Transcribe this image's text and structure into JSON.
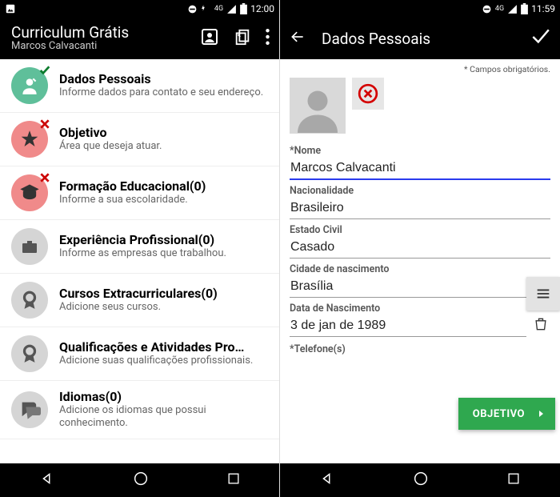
{
  "left": {
    "status": {
      "time": "12:00",
      "net": "4G"
    },
    "app_title": "Curriculum Grátis",
    "app_subtitle": "Marcos Calvacanti",
    "items": [
      {
        "title": "Dados Pessoais",
        "sub": "Informe dados para contato e seu endereço.",
        "color": "green",
        "badge": "check"
      },
      {
        "title": "Objetivo",
        "sub": "Área que deseja atuar.",
        "color": "pink",
        "badge": "x"
      },
      {
        "title": "Formação Educacional(0)",
        "sub": "Informe a sua escolaridade.",
        "color": "pink",
        "badge": "x"
      },
      {
        "title": "Experiência Profissional(0)",
        "sub": "Informe as empresas que trabalhou.",
        "color": "gray",
        "badge": ""
      },
      {
        "title": "Cursos Extracurriculares(0)",
        "sub": "Adicione seus cursos.",
        "color": "gray",
        "badge": ""
      },
      {
        "title": "Qualificações e Atividades Pro…",
        "sub": "Adicione suas qualificações profissionais.",
        "color": "gray",
        "badge": ""
      },
      {
        "title": "Idiomas(0)",
        "sub": "Adicione os idiomas que possui conhecimento.",
        "color": "gray",
        "badge": ""
      }
    ]
  },
  "right": {
    "status": {
      "time": "11:59",
      "net": "4G"
    },
    "screen_title": "Dados Pessoais",
    "required_note": "* Campos obrigatórios.",
    "labels": {
      "name": "*Nome",
      "nationality": "Nacionalidade",
      "marital": "Estado Civil",
      "birth_city": "Cidade de nascimento",
      "dob": "Data de Nascimento",
      "phone": "*Telefone(s)"
    },
    "values": {
      "name": "Marcos Calvacanti",
      "nationality": "Brasileiro",
      "marital": "Casado",
      "birth_city": "Brasília",
      "dob": "3 de jan de 1989"
    },
    "next_button": "OBJETIVO"
  }
}
